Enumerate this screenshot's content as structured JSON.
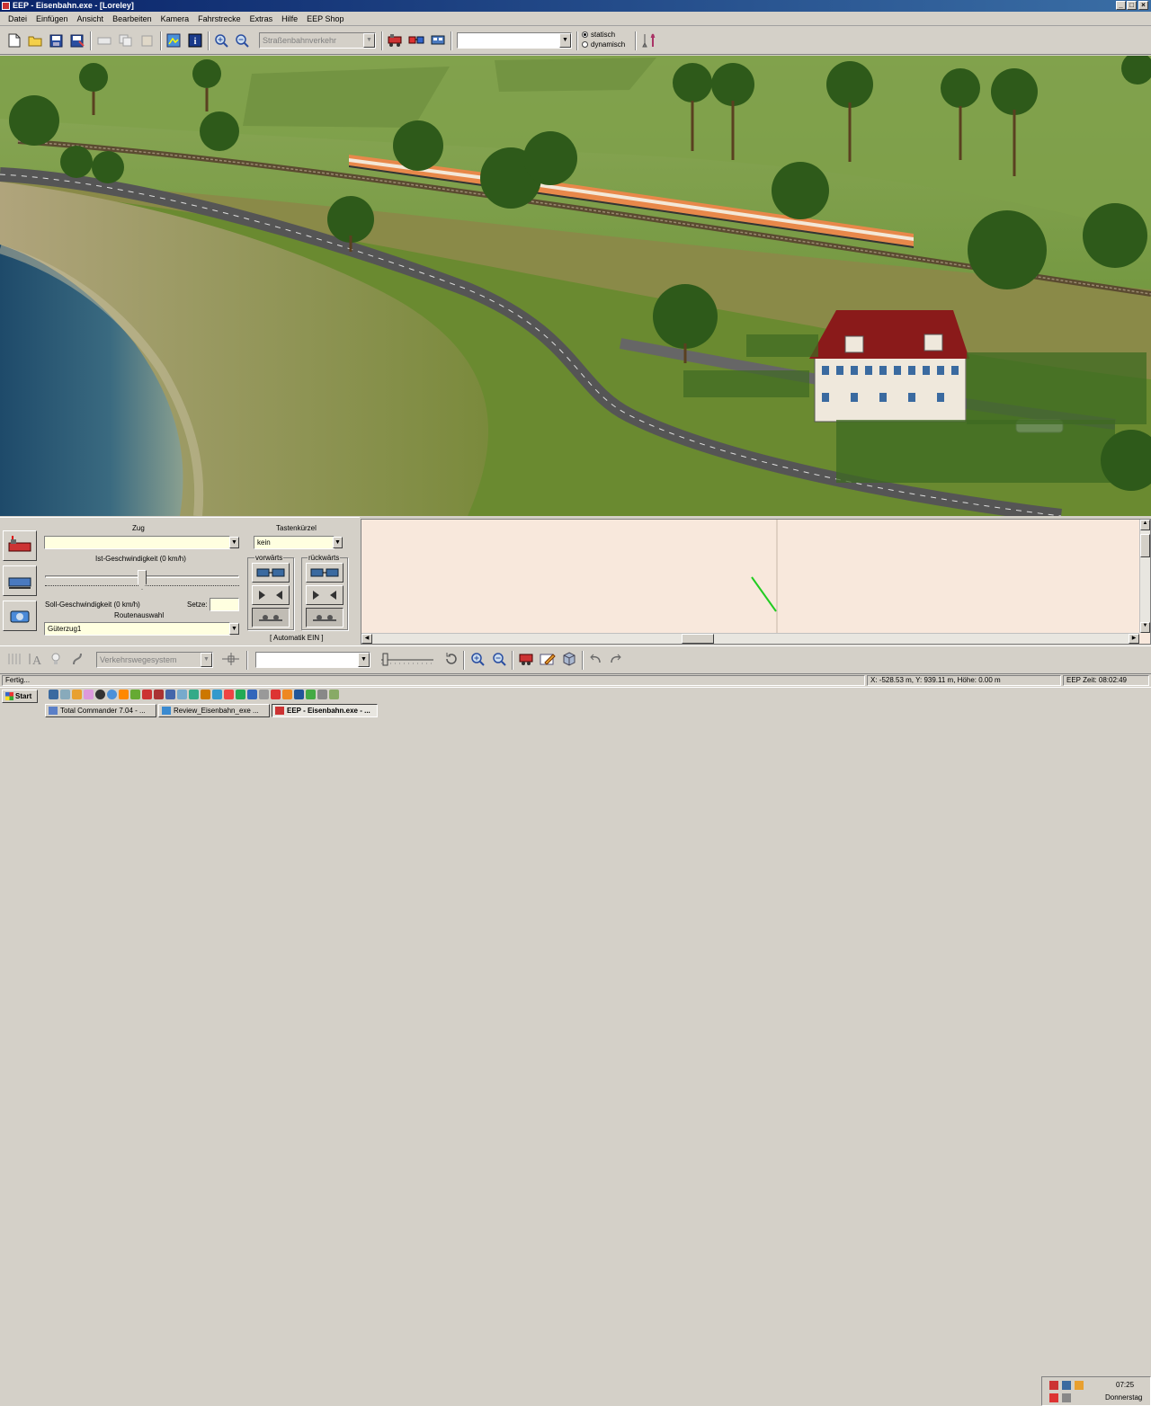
{
  "window": {
    "title": "EEP - Eisenbahn.exe - [Loreley]",
    "minimize": "_",
    "maximize": "□",
    "close": "×"
  },
  "menu": [
    "Datei",
    "Einfügen",
    "Ansicht",
    "Bearbeiten",
    "Kamera",
    "Fahrstrecke",
    "Extras",
    "Hilfe",
    "EEP Shop"
  ],
  "toolbar": {
    "track_system": "Straßenbahnverkehr",
    "search_value": "",
    "radio_static": "statisch",
    "radio_dynamic": "dynamisch",
    "radio_selected": "statisch"
  },
  "panel": {
    "zug_label": "Zug",
    "zug_value": "",
    "tastenkuerzel_label": "Tastenkürzel",
    "tastenkuerzel_value": "kein",
    "ist_speed_label": "Ist-Geschwindigkeit (0 km/h)",
    "soll_speed_label": "Soll-Geschwindigkeit (0 km/h)",
    "setze_label": "Setze:",
    "setze_value": "",
    "route_label": "Routenauswahl",
    "route_value": "Güterzug1",
    "forward_label": "vorwärts",
    "backward_label": "rückwärts",
    "automatik": "[ Automatik EIN ]",
    "speed_slider_fraction": 0.5
  },
  "bottom_toolbar": {
    "path_system": "Verkehrswegesystem",
    "object_value": ""
  },
  "status": {
    "left": "Fertig...",
    "coords": "X: -528.53 m, Y: 939.11 m, Höhe: 0.00 m",
    "time": "EEP Zeit: 08:02:49"
  },
  "taskbar": {
    "start": "Start",
    "tasks": [
      {
        "label": "Total Commander 7.04 - ...",
        "active": false
      },
      {
        "label": "Review_Eisenbahn_exe ...",
        "active": false
      },
      {
        "label": "EEP - Eisenbahn.exe - ...",
        "active": true
      }
    ],
    "clock": "07:25",
    "day": "Donnerstag"
  },
  "colors": {
    "titlebar": "#0a246a",
    "log_background": "#f8e8dc",
    "field_yellow": "#ffffe0",
    "train_orange": "#e8884a"
  }
}
